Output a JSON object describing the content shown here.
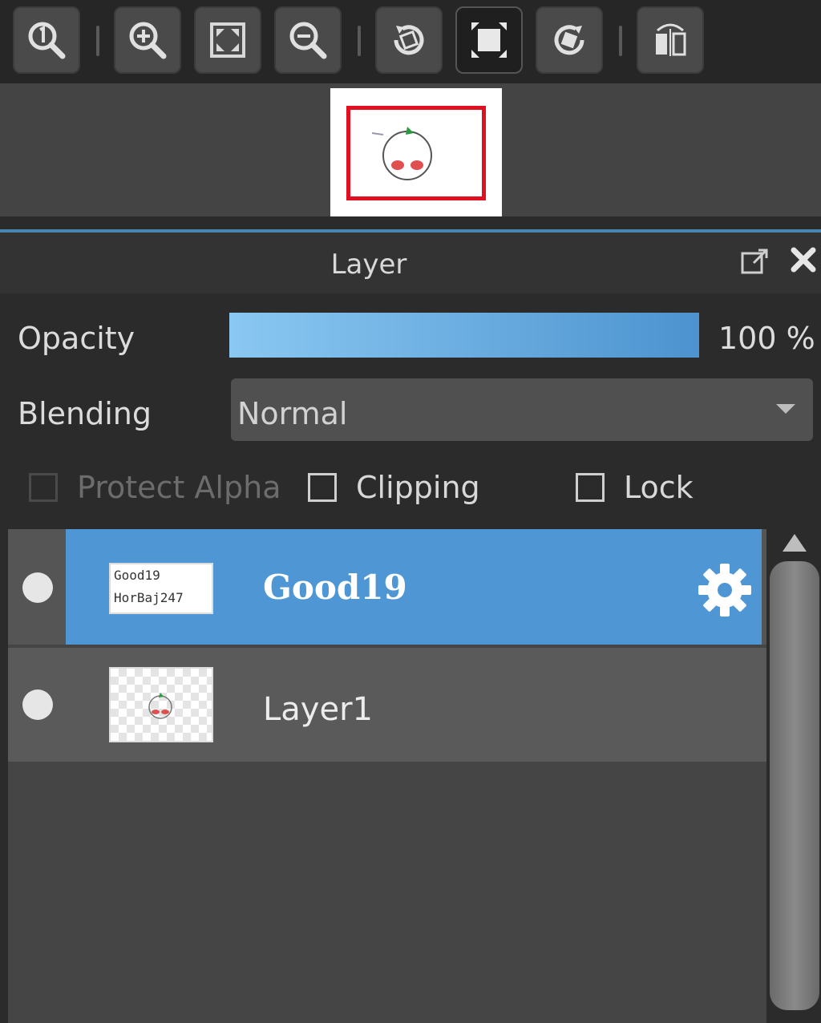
{
  "toolbar": {
    "buttons": [
      {
        "icon": "zoom-actual-icon"
      },
      {
        "icon": "zoom-in-icon"
      },
      {
        "icon": "fit-screen-icon"
      },
      {
        "icon": "zoom-out-icon"
      },
      {
        "icon": "rotate-left-icon"
      },
      {
        "icon": "fit-window-icon",
        "active": true
      },
      {
        "icon": "rotate-right-icon"
      },
      {
        "icon": "flip-horizontal-icon"
      }
    ]
  },
  "panel": {
    "title": "Layer"
  },
  "opacity": {
    "label": "Opacity",
    "value_text": "100 %",
    "value": 100
  },
  "blending": {
    "label": "Blending",
    "value": "Normal"
  },
  "options": {
    "protect_alpha": {
      "label": "Protect Alpha",
      "checked": false,
      "enabled": false
    },
    "clipping": {
      "label": "Clipping",
      "checked": false,
      "enabled": true
    },
    "lock": {
      "label": "Lock",
      "checked": false,
      "enabled": true
    }
  },
  "layers": [
    {
      "name": "Good19",
      "selected": true,
      "thumb_lines": [
        "Good19",
        "HorBaj247"
      ]
    },
    {
      "name": "Layer1",
      "selected": false
    }
  ],
  "colors": {
    "accent": "#4f97d4",
    "view_frame": "#e01020"
  }
}
